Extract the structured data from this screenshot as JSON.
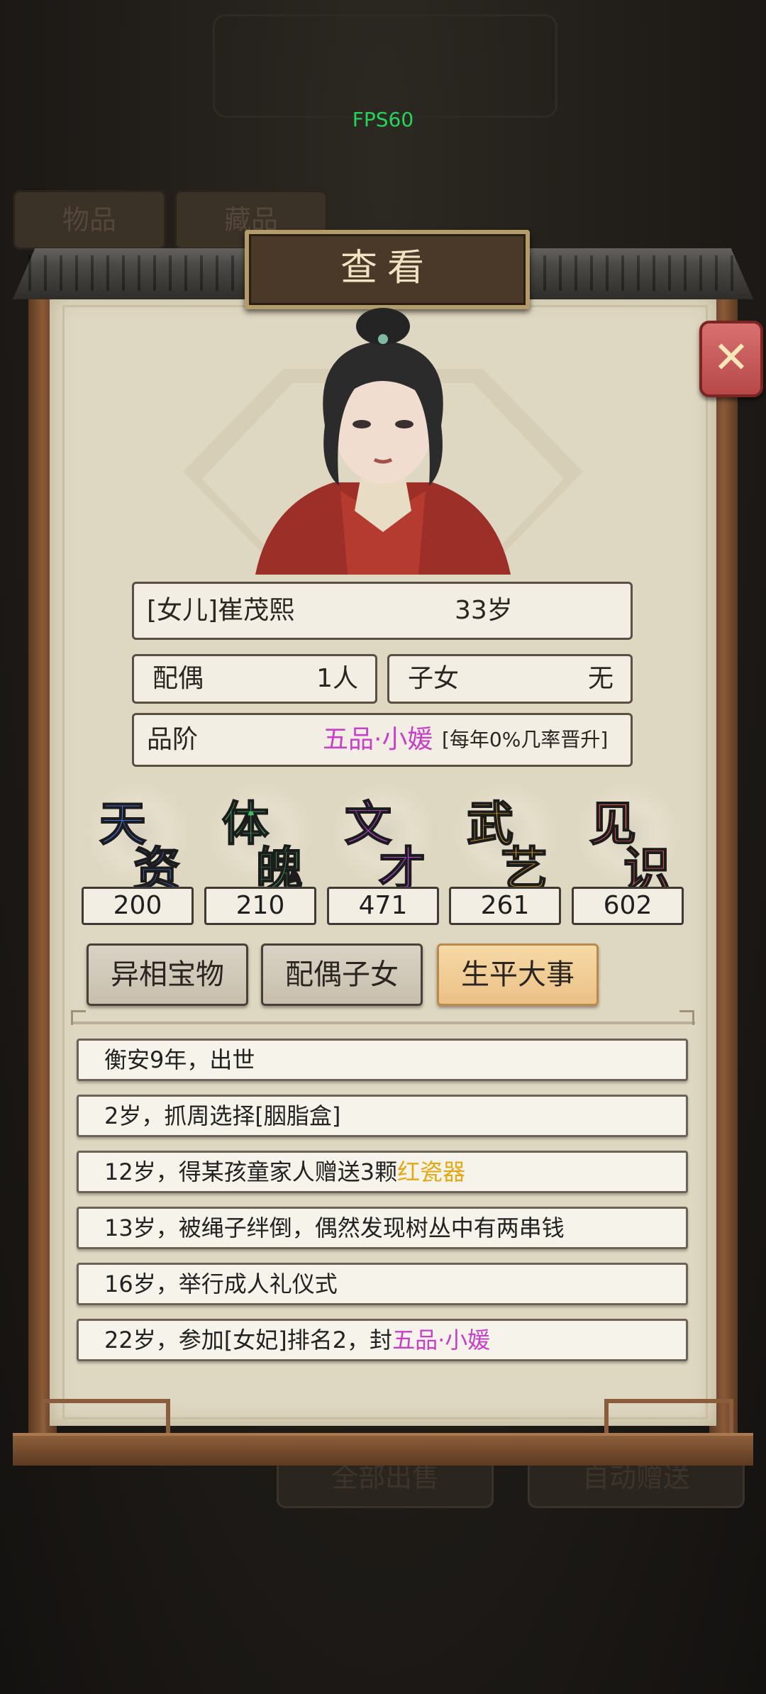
{
  "fps": "FPS60",
  "background": {
    "tabs": [
      "物品",
      "藏品"
    ],
    "bottom_buttons": [
      "全部出售",
      "自动赠送"
    ]
  },
  "dialog": {
    "title": "查看",
    "close_icon": "close-x-icon"
  },
  "profile": {
    "name": "[女儿]崔茂熙",
    "age": "33岁",
    "spouse_label": "配偶",
    "spouse_value": "1人",
    "children_label": "子女",
    "children_value": "无",
    "rank_label": "品阶",
    "rank_value": "五品·小媛",
    "rank_note": "[每年0%几率晋升]"
  },
  "stats": [
    {
      "chars": [
        "天",
        "资"
      ],
      "value": "200",
      "color": "#3f6fd8"
    },
    {
      "chars": [
        "体",
        "魄"
      ],
      "value": "210",
      "color": "#3fbf63"
    },
    {
      "chars": [
        "文",
        "才"
      ],
      "value": "471",
      "color": "#b34ad6"
    },
    {
      "chars": [
        "武",
        "艺"
      ],
      "value": "261",
      "color": "#e0a52a"
    },
    {
      "chars": [
        "见",
        "识"
      ],
      "value": "602",
      "color": "#e05a5a"
    }
  ],
  "tabs": [
    "异相宝物",
    "配偶子女",
    "生平大事"
  ],
  "active_tab": "生平大事",
  "events": [
    {
      "text": "衡安9年，出世",
      "highlight": "",
      "highlight_color": ""
    },
    {
      "text": "2岁，抓周选择[胭脂盒]",
      "highlight": "",
      "highlight_color": ""
    },
    {
      "text": "12岁，得某孩童家人赠送3颗",
      "highlight": "红瓷器",
      "highlight_color": "gold"
    },
    {
      "text": "13岁，被绳子绊倒，偶然发现树丛中有两串钱",
      "highlight": "",
      "highlight_color": ""
    },
    {
      "text": "16岁，举行成人礼仪式",
      "highlight": "",
      "highlight_color": ""
    },
    {
      "text": "22岁，参加[女妃]排名2，封",
      "highlight": "五品·小媛",
      "highlight_color": "pink"
    }
  ]
}
